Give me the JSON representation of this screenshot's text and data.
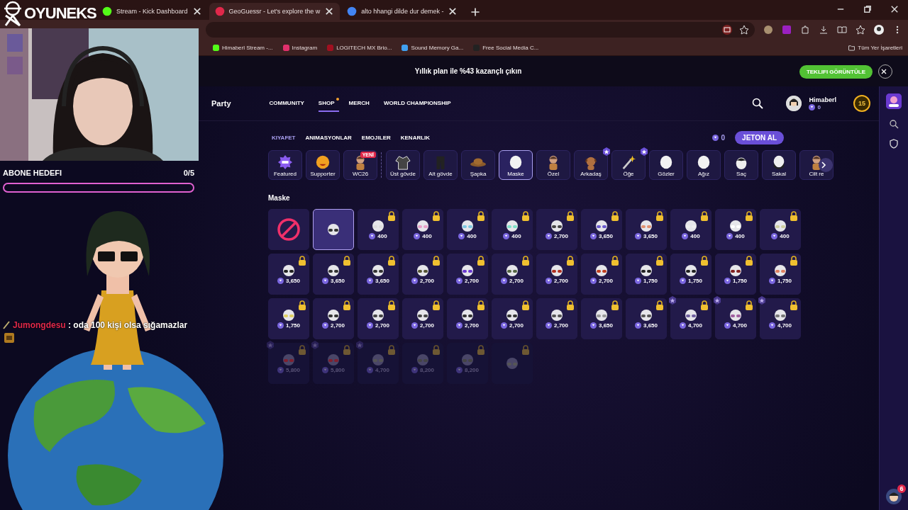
{
  "browser": {
    "tabs": [
      {
        "title": "Stream - Kick Dashboard",
        "selected": false
      },
      {
        "title": "GeoGuessr - Let's explore the w",
        "selected": true
      },
      {
        "title": "alto hhangi dilde dur demek -",
        "selected": false
      }
    ],
    "bookmarks": [
      {
        "label": "Himaberl Stream -..."
      },
      {
        "label": "Instagram"
      },
      {
        "label": "LOGITECH MX Brio..."
      },
      {
        "label": "Sound Memory Ga..."
      },
      {
        "label": "Free Social Media C..."
      }
    ],
    "all_bookmarks": "Tüm Yer İşaretleri"
  },
  "banner": {
    "text": "Yıllık plan ile %43 kazançlı çıkın",
    "button": "TEKLIFI GÖRÜNTÜLE"
  },
  "nav": {
    "party": "Party",
    "links": [
      {
        "label": "COMMUNITY",
        "selected": false,
        "dot": false
      },
      {
        "label": "SHOP",
        "selected": true,
        "dot": true
      },
      {
        "label": "MERCH",
        "selected": false,
        "dot": false
      },
      {
        "label": "WORLD CHAMPIONSHIP",
        "selected": false,
        "dot": false
      }
    ],
    "user": {
      "name": "Himaberl",
      "coins": "0"
    },
    "level": "15"
  },
  "shop": {
    "tabs": [
      {
        "label": "KIYAFET",
        "selected": true
      },
      {
        "label": "ANIMASYONLAR",
        "selected": false
      },
      {
        "label": "EMOJILER",
        "selected": false
      },
      {
        "label": "KENARLIK",
        "selected": false
      }
    ],
    "coins": "0",
    "buy_button": "JETON AL",
    "categories": [
      {
        "label": "Featured",
        "kind": "new",
        "selected": false
      },
      {
        "label": "Supporter",
        "kind": "emoji",
        "selected": false
      },
      {
        "label": "WC26",
        "kind": "figure",
        "selected": false,
        "badge": "YENİ"
      },
      {
        "label": "Üst gövde",
        "kind": "shirt",
        "selected": false,
        "divider_before": true
      },
      {
        "label": "Alt gövde",
        "kind": "pants",
        "selected": false
      },
      {
        "label": "Şapka",
        "kind": "hat",
        "selected": false
      },
      {
        "label": "Maske",
        "kind": "head",
        "selected": true
      },
      {
        "label": "Özel",
        "kind": "figure",
        "selected": false
      },
      {
        "label": "Arkadaş",
        "kind": "dog",
        "selected": false,
        "star": true
      },
      {
        "label": "Öğe",
        "kind": "wand",
        "selected": false,
        "star": true
      },
      {
        "label": "Gözler",
        "kind": "head",
        "selected": false
      },
      {
        "label": "Ağız",
        "kind": "head",
        "selected": false
      },
      {
        "label": "Saç",
        "kind": "hair",
        "selected": false
      },
      {
        "label": "Sakal",
        "kind": "beard",
        "selected": false
      },
      {
        "label": "Cilt re",
        "kind": "figure",
        "selected": false
      }
    ],
    "section_title": "Maske",
    "items": [
      {
        "kind": "none",
        "selected": false
      },
      {
        "kind": "mask",
        "selected": true,
        "locked": false,
        "color": "#333333"
      },
      {
        "kind": "mask",
        "selected": false,
        "locked": true,
        "price": "400",
        "color": "#dddddd"
      },
      {
        "kind": "mask",
        "selected": false,
        "locked": true,
        "price": "400",
        "color": "#e8a0c8"
      },
      {
        "kind": "mask",
        "selected": false,
        "locked": true,
        "price": "400",
        "color": "#7fc8e0"
      },
      {
        "kind": "mask",
        "selected": false,
        "locked": true,
        "price": "400",
        "color": "#7fe0c8"
      },
      {
        "kind": "mask",
        "selected": false,
        "locked": true,
        "price": "2,700",
        "color": "#444444"
      },
      {
        "kind": "mask",
        "selected": false,
        "locked": true,
        "price": "3,650",
        "color": "#6a5acd"
      },
      {
        "kind": "mask",
        "selected": false,
        "locked": true,
        "price": "3,650",
        "color": "#e09070"
      },
      {
        "kind": "mask",
        "selected": false,
        "locked": true,
        "price": "400",
        "color": "#eeeeee"
      },
      {
        "kind": "mask",
        "selected": false,
        "locked": true,
        "price": "400",
        "color": "#ffffff"
      },
      {
        "kind": "mask",
        "selected": false,
        "locked": true,
        "price": "400",
        "color": "#cfcfa0"
      },
      {
        "kind": "mask",
        "selected": false,
        "locked": true,
        "price": "3,650",
        "color": "#222222"
      },
      {
        "kind": "mask",
        "selected": false,
        "locked": true,
        "price": "3,650",
        "color": "#333333"
      },
      {
        "kind": "mask",
        "selected": false,
        "locked": true,
        "price": "3,650",
        "color": "#333333"
      },
      {
        "kind": "mask",
        "selected": false,
        "locked": true,
        "price": "2,700",
        "color": "#555533"
      },
      {
        "kind": "mask",
        "selected": false,
        "locked": true,
        "price": "2,700",
        "color": "#6a3ad0"
      },
      {
        "kind": "mask",
        "selected": false,
        "locked": true,
        "price": "2,700",
        "color": "#556644"
      },
      {
        "kind": "mask",
        "selected": false,
        "locked": true,
        "price": "2,700",
        "color": "#b03020"
      },
      {
        "kind": "mask",
        "selected": false,
        "locked": true,
        "price": "2,700",
        "color": "#c04020"
      },
      {
        "kind": "mask",
        "selected": false,
        "locked": true,
        "price": "1,750",
        "color": "#222222"
      },
      {
        "kind": "mask",
        "selected": false,
        "locked": true,
        "price": "1,750",
        "color": "#222222"
      },
      {
        "kind": "mask",
        "selected": false,
        "locked": true,
        "price": "1,750",
        "color": "#802020"
      },
      {
        "kind": "mask",
        "selected": false,
        "locked": true,
        "price": "1,750",
        "color": "#e08060"
      },
      {
        "kind": "mask",
        "selected": false,
        "locked": true,
        "price": "1,750",
        "color": "#e0d060"
      },
      {
        "kind": "mask",
        "selected": false,
        "locked": true,
        "price": "2,700",
        "color": "#333333"
      },
      {
        "kind": "mask",
        "selected": false,
        "locked": true,
        "price": "2,700",
        "color": "#444444"
      },
      {
        "kind": "mask",
        "selected": false,
        "locked": true,
        "price": "2,700",
        "color": "#444444"
      },
      {
        "kind": "mask",
        "selected": false,
        "locked": true,
        "price": "2,700",
        "color": "#333333"
      },
      {
        "kind": "mask",
        "selected": false,
        "locked": true,
        "price": "2,700",
        "color": "#333333"
      },
      {
        "kind": "mask",
        "selected": false,
        "locked": true,
        "price": "2,700",
        "color": "#555555"
      },
      {
        "kind": "mask",
        "selected": false,
        "locked": true,
        "price": "3,650",
        "color": "#999999"
      },
      {
        "kind": "mask",
        "selected": false,
        "locked": true,
        "price": "3,650",
        "color": "#555555"
      },
      {
        "kind": "mask",
        "selected": false,
        "locked": true,
        "price": "4,700",
        "color": "#7060a0",
        "premium": true
      },
      {
        "kind": "mask",
        "selected": false,
        "locked": true,
        "price": "4,700",
        "color": "#a060a0",
        "premium": true
      },
      {
        "kind": "mask",
        "selected": false,
        "locked": true,
        "price": "4,700",
        "color": "#777777",
        "premium": true
      },
      {
        "kind": "mask",
        "selected": false,
        "locked": true,
        "price": "5,800",
        "color": "#802030",
        "premium": true,
        "dim": true
      },
      {
        "kind": "mask",
        "selected": false,
        "locked": true,
        "price": "5,800",
        "color": "#802030",
        "premium": true,
        "dim": true
      },
      {
        "kind": "mask",
        "selected": false,
        "locked": true,
        "price": "4,700",
        "color": "#555555",
        "premium": true,
        "dim": true
      },
      {
        "kind": "mask",
        "selected": false,
        "locked": true,
        "price": "8,200",
        "color": "#444444",
        "dim": true
      },
      {
        "kind": "mask",
        "selected": false,
        "locked": true,
        "price": "8,200",
        "color": "#444444",
        "dim": true
      },
      {
        "kind": "mask",
        "selected": false,
        "locked": true,
        "color": "#555555",
        "dim": true
      }
    ]
  },
  "overlay": {
    "logo": "OYUNEKS",
    "goal": {
      "label": "ABONE HEDEFI",
      "count": "0/5",
      "level": 0
    },
    "chat": {
      "user": "Jumongdesu",
      "message": ": oda 100 kişi olsa sığamazlar"
    },
    "notification_count": "6"
  }
}
